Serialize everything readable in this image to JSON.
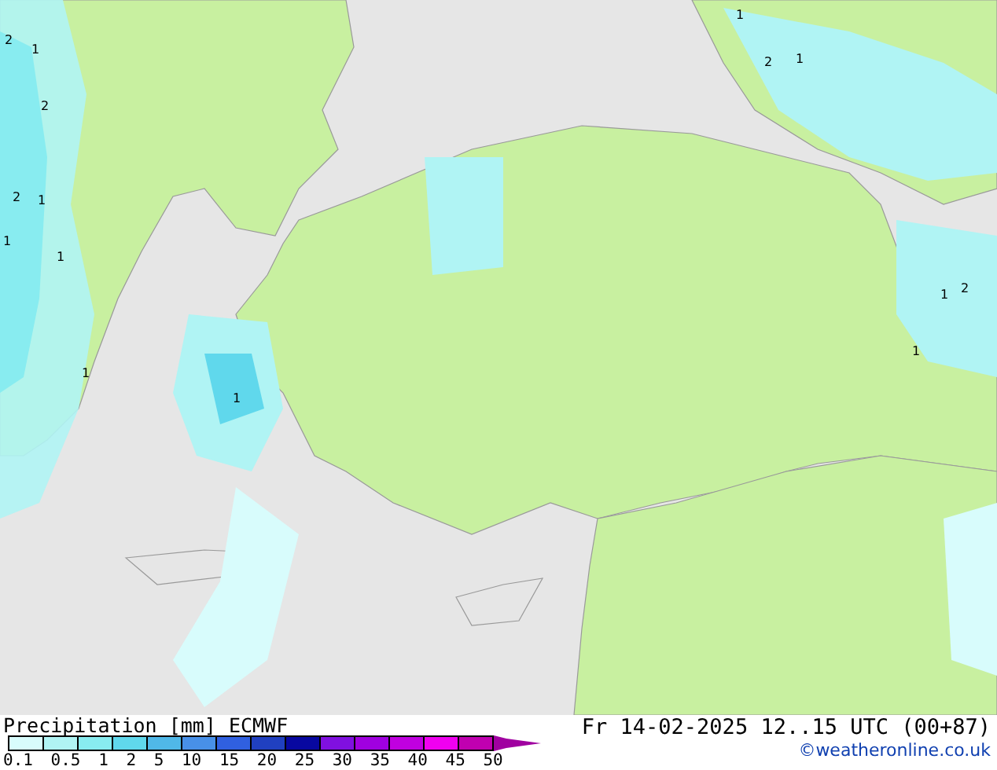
{
  "map_labels": [
    {
      "text": "2"
    },
    {
      "text": "1"
    },
    {
      "text": "2"
    },
    {
      "text": "2"
    },
    {
      "text": "1"
    },
    {
      "text": "1"
    },
    {
      "text": "1"
    },
    {
      "text": "1"
    },
    {
      "text": "1"
    },
    {
      "text": "2"
    },
    {
      "text": "1"
    },
    {
      "text": "1"
    },
    {
      "text": "1"
    },
    {
      "text": "2"
    },
    {
      "text": "1"
    }
  ],
  "legend": {
    "title": "Precipitation [mm]",
    "model": "ECMWF",
    "scale": [
      {
        "label": "0.1",
        "color": "#d8fcfc"
      },
      {
        "label": "0.5",
        "color": "#b0f4f4"
      },
      {
        "label": "1",
        "color": "#88ecf0"
      },
      {
        "label": "2",
        "color": "#60d8ec"
      },
      {
        "label": "5",
        "color": "#50b8e8"
      },
      {
        "label": "10",
        "color": "#4890e8"
      },
      {
        "label": "15",
        "color": "#3060e0"
      },
      {
        "label": "20",
        "color": "#2040c0"
      },
      {
        "label": "25",
        "color": "#0808a0"
      },
      {
        "label": "30",
        "color": "#8010e0"
      },
      {
        "label": "35",
        "color": "#a000e0"
      },
      {
        "label": "40",
        "color": "#c000e0"
      },
      {
        "label": "45",
        "color": "#f000f0"
      },
      {
        "label": "50",
        "color": "#c000b0"
      }
    ]
  },
  "valid_time": "Fr 14-02-2025 12..15 UTC (00+87)",
  "credit": "©weatheronline.co.uk"
}
